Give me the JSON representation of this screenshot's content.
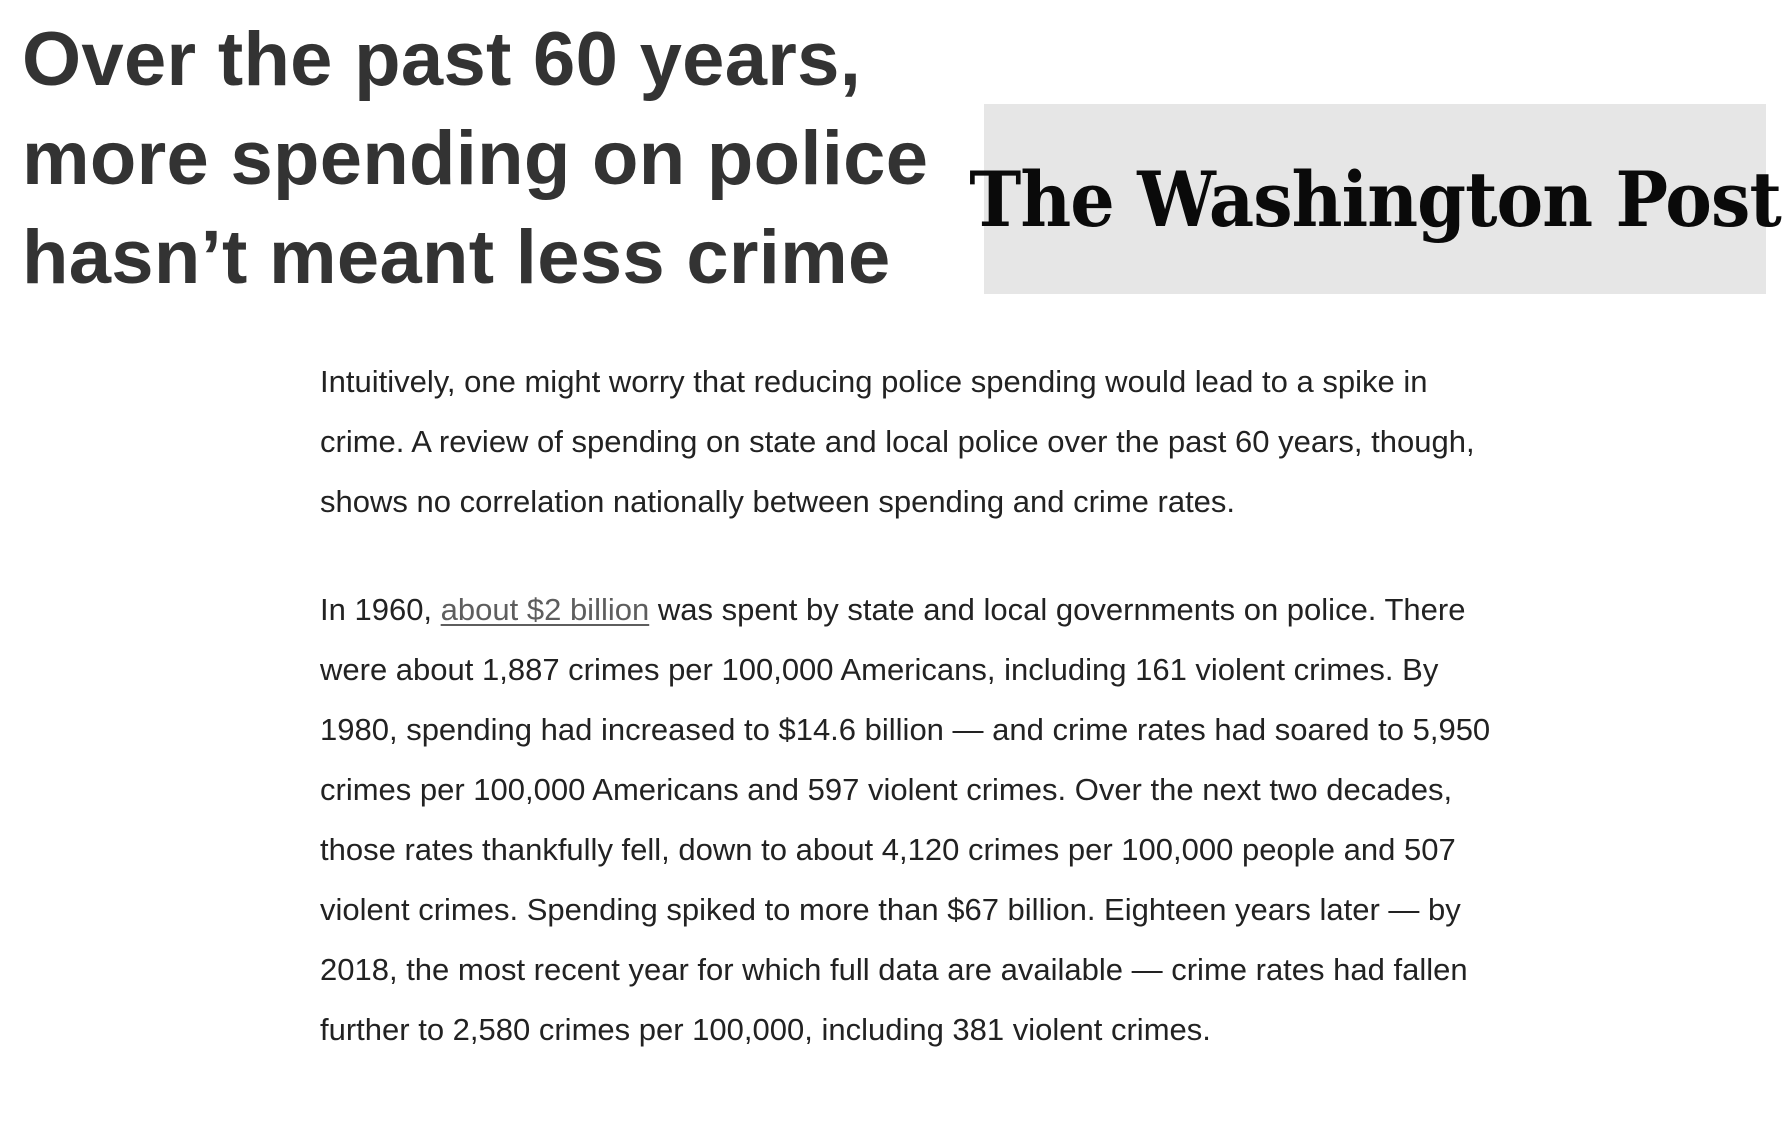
{
  "article": {
    "headline": "Over the past 60 years, more spending on police hasn’t meant less crime",
    "publication": "The Washington Post",
    "paragraph1": "Intuitively, one might worry that reducing police spending would lead to a spike in crime. A review of spending on state and local police over the past 60 years, though, shows no correlation nationally between spending and crime rates.",
    "paragraph2": {
      "before_link": "In 1960, ",
      "link_text": "about $2 billion",
      "after_link": " was spent by state and local governments on police. There were about 1,887 crimes per 100,000 Americans, including 161 violent crimes. By 1980, spending had increased to $14.6 billion — and crime rates had soared to 5,950 crimes per 100,000 Americans and 597 violent crimes. Over the next two decades, those rates thankfully fell, down to about 4,120 crimes per 100,000 people and 507 violent crimes. Spending spiked to more than $67 billion. Eighteen years later — by 2018, the most recent year for which full data are available — crime rates had fallen further to 2,580 crimes per 100,000, including 381 violent crimes."
    }
  },
  "colors": {
    "headline": "#333333",
    "body_text": "#222222",
    "link": "#5e5e5e",
    "masthead_background": "#e6e6e6"
  }
}
